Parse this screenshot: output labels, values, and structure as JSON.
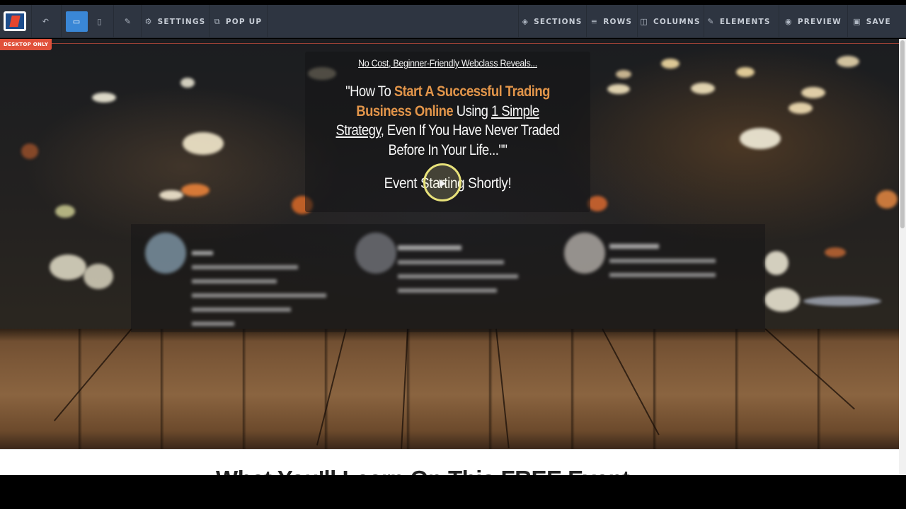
{
  "toolbar": {
    "undo_icon": "undo-icon",
    "desktop_icon": "desktop-icon",
    "mobile_icon": "mobile-icon",
    "tools_icon": "wrench-icon",
    "settings_label": "SETTINGS",
    "popup_label": "POP UP",
    "sections_label": "SECTIONS",
    "rows_label": "ROWS",
    "columns_label": "COLUMNS",
    "elements_label": "ELEMENTS",
    "preview_label": "PREVIEW",
    "save_label": "SAVE"
  },
  "badge": {
    "desktop_only": "DESKTOP ONLY"
  },
  "hero": {
    "teaser": "No Cost, Beginner-Friendly Webclass Reveals...",
    "headline": {
      "part1": "\"How To ",
      "highlight": "Start A Successful Trading Business Online",
      "part2": " Using ",
      "underlined": "1 Simple Strategy",
      "part3": ", Even If You Have Never Traded Before In Your Life...\"\""
    },
    "event_text": "Event Starting Shortly!"
  },
  "section_heading": "What You'll Learn On This FREE Event",
  "colors": {
    "toolbar_bg": "#2e3541",
    "active_button": "#3a87d6",
    "headline_accent": "#e2954a",
    "badge_red": "#e0513b"
  }
}
